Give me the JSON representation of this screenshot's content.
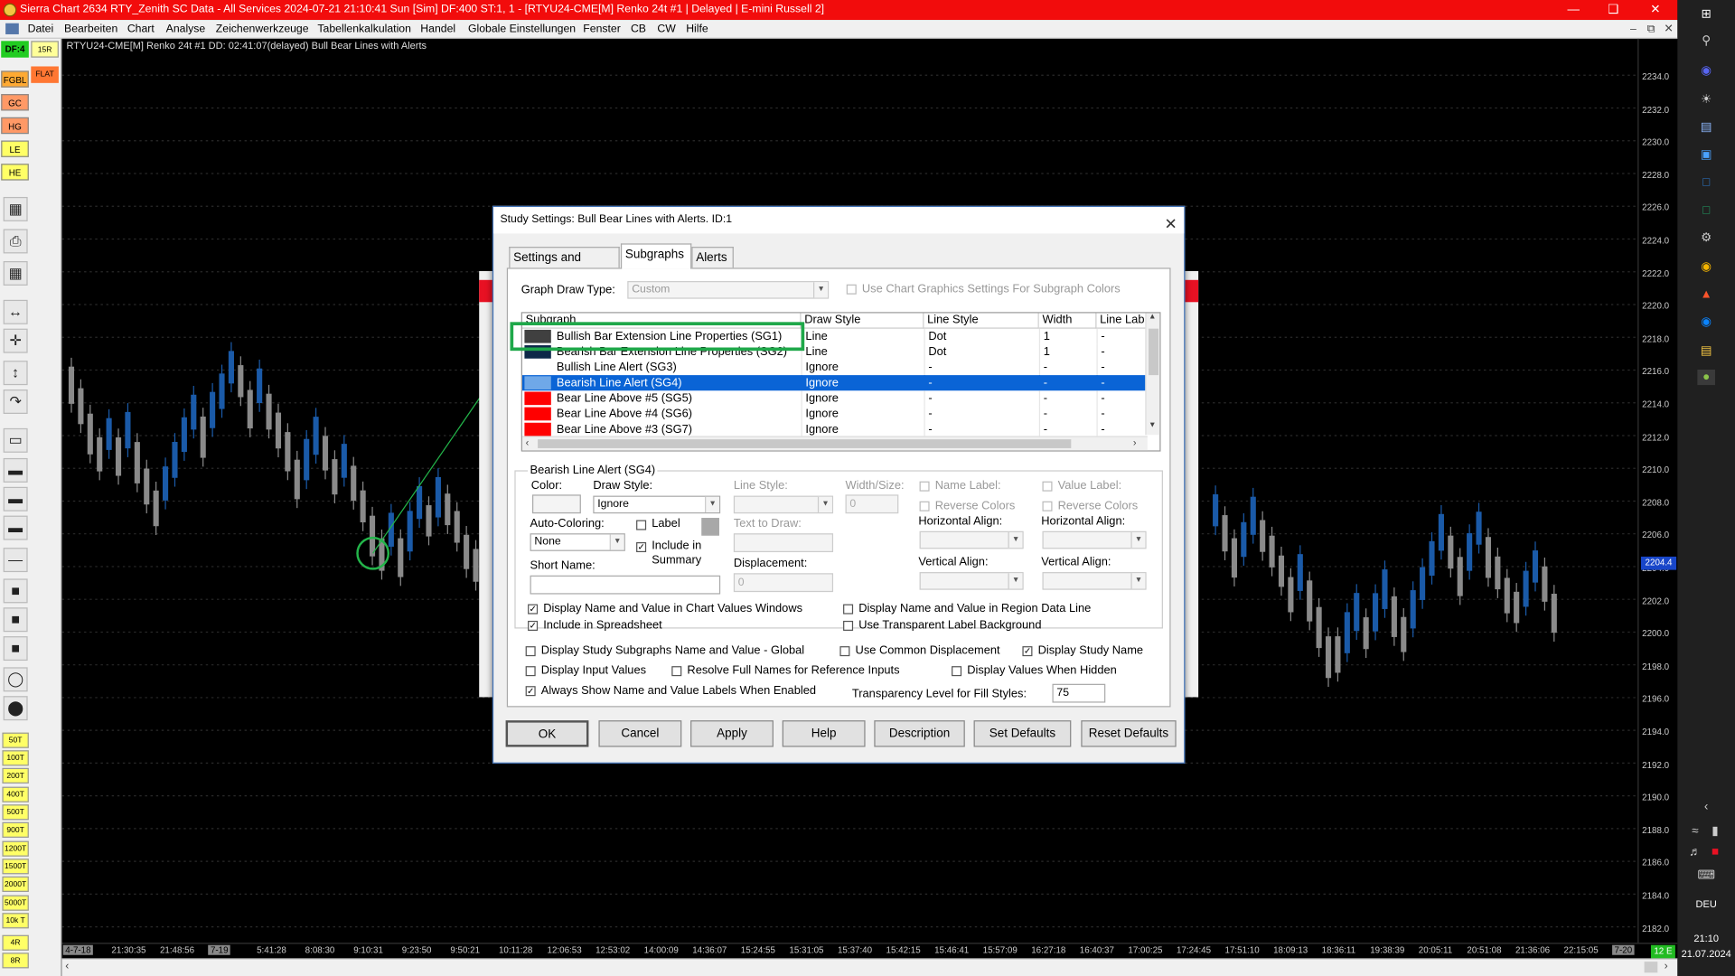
{
  "window": {
    "title": "Sierra Chart 2634 RTY_Zenith SC Data - All Services 2024-07-21  21:10:41 Sun [Sim] DF:400  ST:1, 1 - [RTYU24-CME[M]  Renko 24t #1 | Delayed | E-mini Russell 2]"
  },
  "menu": [
    "Datei",
    "Bearbeiten",
    "Chart",
    "Analyse",
    "Zeichenwerkzeuge",
    "Tabellenkalkulation",
    "Handel",
    "Globale Einstellungen",
    "Fenster",
    "CB",
    "CW",
    "Hilfe"
  ],
  "left_toolbar": {
    "df_label": "DF:4",
    "tf_label": "15R",
    "flat_label": "FLAT",
    "symbols": [
      "FGBL",
      "GC",
      "HG",
      "LE",
      "HE"
    ],
    "bar_types": [
      "50T",
      "100T",
      "200T",
      "400T",
      "500T",
      "900T",
      "1200T",
      "1500T",
      "2000T",
      "5000T",
      "10k T",
      "4R",
      "8R"
    ]
  },
  "chart": {
    "header": "RTYU24-CME[M]  Renko 24t #1  DD: 02:41:07(delayed)  Bull Bear Lines with Alerts",
    "price_labels": [
      "2234.0",
      "2232.0",
      "2230.0",
      "2228.0",
      "2226.0",
      "2224.0",
      "2222.0",
      "2220.0",
      "2218.0",
      "2216.0",
      "2214.0",
      "2212.0",
      "2210.0",
      "2208.0",
      "2206.0",
      "2204.0",
      "2202.0",
      "2200.0",
      "2198.0",
      "2196.0",
      "2194.0",
      "2192.0",
      "2190.0",
      "2188.0",
      "2186.0",
      "2184.0",
      "2182.0"
    ],
    "current_price": "2204.4",
    "time_labels": [
      "4-7-18",
      "21:30:35",
      "21:48:56",
      "7-19",
      "5:41:28",
      "8:08:30",
      "9:10:31",
      "9:23:50",
      "9:50:21",
      "10:11:28",
      "12:06:53",
      "12:53:02",
      "14:00:09",
      "14:36:07",
      "15:24:55",
      "15:31:05",
      "15:37:40",
      "15:42:15",
      "15:46:41",
      "15:57:09",
      "16:27:18",
      "16:40:37",
      "17:00:25",
      "17:24:45",
      "17:51:10",
      "18:09:13",
      "18:36:11",
      "19:38:39",
      "20:05:11",
      "20:51:08",
      "21:36:06",
      "22:15:05",
      "7-20"
    ],
    "time_right_tag": "12 E"
  },
  "taskbar": {
    "time": "21:10",
    "date": "21.07.2024",
    "lang": "DEU"
  },
  "dialog": {
    "title": "Study Settings: Bull Bear Lines with Alerts. ID:1",
    "tabs": [
      "Settings and Inputs",
      "Subgraphs",
      "Alerts"
    ],
    "graph_draw_type_label": "Graph Draw Type:",
    "graph_draw_type_value": "Custom",
    "use_chart_graphics_label": "Use Chart Graphics Settings For Subgraph Colors",
    "columns": [
      "Subgraph",
      "Draw Style",
      "Line Style",
      "Width",
      "Line Lab"
    ],
    "rows": [
      {
        "name": "Bullish Bar Extension Line Properties (SG1)",
        "draw": "Line",
        "line": "Dot",
        "width": "1",
        "lab": "-",
        "color": "#404040"
      },
      {
        "name": "Bearish Bar Extension Line Properties (SG2)",
        "draw": "Line",
        "line": "Dot",
        "width": "1",
        "lab": "-",
        "color": "#0d2748"
      },
      {
        "name": "Bullish Line Alert (SG3)",
        "draw": "Ignore",
        "line": "-",
        "width": "-",
        "lab": "-",
        "color": "#ffffff"
      },
      {
        "name": "Bearish Line Alert (SG4)",
        "draw": "Ignore",
        "line": "-",
        "width": "-",
        "lab": "-",
        "color": "#6fa8e8"
      },
      {
        "name": "Bear Line Above #5 (SG5)",
        "draw": "Ignore",
        "line": "-",
        "width": "-",
        "lab": "-",
        "color": "#ff0000"
      },
      {
        "name": "Bear Line Above #4 (SG6)",
        "draw": "Ignore",
        "line": "-",
        "width": "-",
        "lab": "-",
        "color": "#ff0000"
      },
      {
        "name": "Bear Line Above #3 (SG7)",
        "draw": "Ignore",
        "line": "-",
        "width": "-",
        "lab": "-",
        "color": "#ff0000"
      }
    ],
    "group_title": "Bearish Line Alert (SG4)",
    "color_label": "Color:",
    "draw_style_label": "Draw Style:",
    "draw_style_value": "Ignore",
    "line_style_label": "Line Style:",
    "width_label": "Width/Size:",
    "width_value": "0",
    "name_label_label": "Name Label:",
    "value_label_label": "Value Label:",
    "reverse_colors_label": "Reverse Colors",
    "h_align_label": "Horizontal Align:",
    "v_align_label": "Vertical Align:",
    "auto_coloring_label": "Auto-Coloring:",
    "auto_coloring_value": "None",
    "label_chk": "Label",
    "include_summary_1": "Include in",
    "include_summary_2": "Summary",
    "text_to_draw_label": "Text to Draw:",
    "short_name_label": "Short Name:",
    "displacement_label": "Displacement:",
    "displacement_value": "0",
    "chk_display_values_windows": "Display Name and Value in Chart Values Windows",
    "chk_display_region": "Display Name and Value in Region Data Line",
    "chk_spreadsheet": "Include in Spreadsheet",
    "chk_transparent_label": "Use Transparent Label Background",
    "chk_display_global": "Display Study Subgraphs Name and Value - Global",
    "chk_common_displacement": "Use Common Displacement",
    "chk_display_study_name": "Display Study Name",
    "chk_display_inputs": "Display Input Values",
    "chk_resolve_names": "Resolve Full Names for Reference Inputs",
    "chk_values_hidden": "Display Values When Hidden",
    "chk_always_show": "Always Show Name and Value Labels When Enabled",
    "transparency_label": "Transparency Level for Fill Styles:",
    "transparency_value": "75",
    "buttons": [
      "OK",
      "Cancel",
      "Apply",
      "Help",
      "Description",
      "Set Defaults",
      "Reset Defaults"
    ]
  }
}
